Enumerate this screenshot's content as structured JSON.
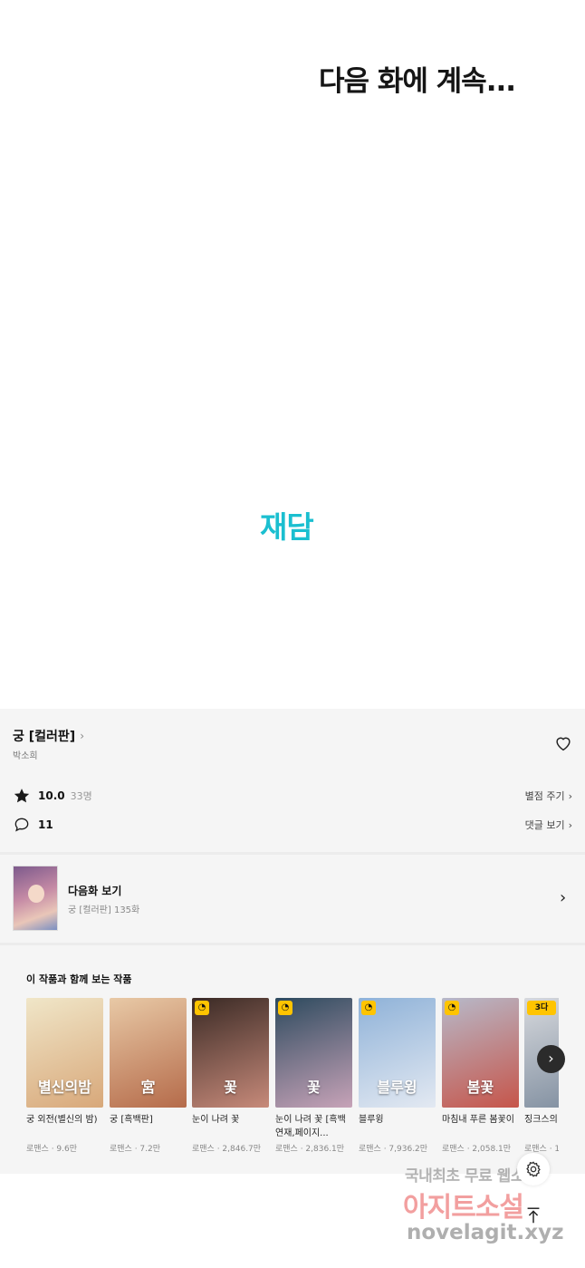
{
  "comic": {
    "caption": "다음 화에 계속...",
    "logo": "재담"
  },
  "work": {
    "title": "궁 [컬러판]",
    "author": "박소희",
    "rating": "10.0",
    "rating_count": "33명",
    "rate_action": "별점 주기",
    "comments": "11",
    "comment_action": "댓글 보기"
  },
  "next_episode": {
    "label": "다음화 보기",
    "subtitle": "궁 [컬러판] 135화"
  },
  "recommendations": {
    "heading": "이 작품과 함께 보는 작품",
    "items": [
      {
        "name": "궁 외전(별신의 밤)",
        "meta": "로맨스 · 9.6만",
        "badge": "",
        "cover_text": "별신의밤",
        "c1": "#f0e6c8",
        "c2": "#d8a87a"
      },
      {
        "name": "궁 [흑백판]",
        "meta": "로맨스 · 7.2만",
        "badge": "",
        "cover_text": "宮",
        "c1": "#e8c9a6",
        "c2": "#b56b4a"
      },
      {
        "name": "눈이 나려 꽃",
        "meta": "로맨스 · 2,846.7만",
        "badge": "◔",
        "cover_text": "꽃",
        "c1": "#3a2a25",
        "c2": "#c78a7a"
      },
      {
        "name": "눈이 나려 꽃 [흑백연재,페이지...",
        "meta": "로맨스 · 2,836.1만",
        "badge": "◔",
        "cover_text": "꽃",
        "c1": "#2d4a5e",
        "c2": "#c7a3b8"
      },
      {
        "name": "블루윙",
        "meta": "로맨스 · 7,936.2만",
        "badge": "◔",
        "cover_text": "블루윙",
        "c1": "#8fb2d8",
        "c2": "#e3e9f2"
      },
      {
        "name": "마침내 푸른 봄꽃이",
        "meta": "로맨스 · 2,058.1만",
        "badge": "◔",
        "cover_text": "봄꽃",
        "c1": "#b7b9c9",
        "c2": "#c6554a"
      },
      {
        "name": "징크스의",
        "meta": "로맨스 · 1",
        "badge": "3다",
        "cover_text": "",
        "c1": "#d7d9dd",
        "c2": "#7b8a9c"
      }
    ]
  },
  "icons": {
    "rating": "star-icon",
    "comment": "comment-icon",
    "favorite": "heart-icon",
    "settings": "gear-icon",
    "scroll_top": "arrow-up-icon"
  },
  "watermark": {
    "line1": "국내최초 무료 웹소설",
    "line2": "아지트소설",
    "line3": "novelagit.xyz"
  },
  "colors": {
    "logo": "#1bbfd0",
    "panel_bg": "#f5f5f5",
    "badge": "#ffc400"
  }
}
